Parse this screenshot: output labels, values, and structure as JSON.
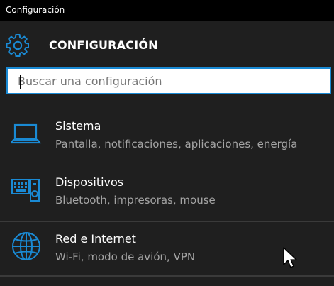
{
  "window": {
    "title": "Configuración"
  },
  "header": {
    "title": "CONFIGURACIÓN",
    "icon": "gear-icon"
  },
  "search": {
    "placeholder": "Buscar una configuración",
    "value": ""
  },
  "sections": [
    {
      "title": "Sistema",
      "subtitle": "Pantalla, notificaciones, aplicaciones, energía",
      "icon": "laptop-icon"
    },
    {
      "title": "Dispositivos",
      "subtitle": "Bluetooth, impresoras, mouse",
      "icon": "devices-icon"
    },
    {
      "title": "Red e Internet",
      "subtitle": "Wi-Fi, modo de avión, VPN",
      "icon": "globe-icon"
    }
  ],
  "colors": {
    "accent": "#1a8ad4",
    "background": "#1f1f1f",
    "titlebar": "#000000",
    "text": "#ffffff",
    "subtext": "#a5a5a5"
  }
}
